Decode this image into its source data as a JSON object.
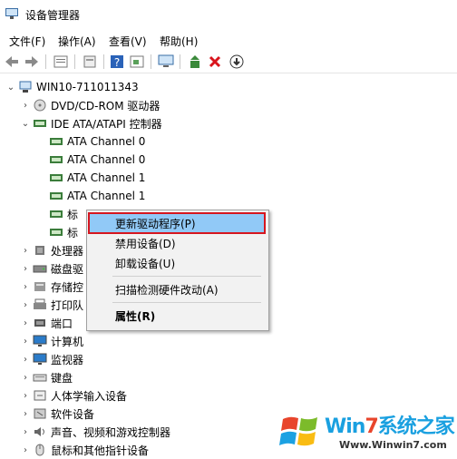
{
  "window": {
    "title": "设备管理器"
  },
  "menu": [
    "文件(F)",
    "操作(A)",
    "查看(V)",
    "帮助(H)"
  ],
  "toolbar_icons": [
    "back-arrow-icon",
    "forward-arrow-icon",
    "properties-icon",
    "show-hidden-icon",
    "help-icon",
    "details-icon",
    "computer-icon",
    "update-driver-icon",
    "uninstall-x-icon",
    "download-icon"
  ],
  "tree": {
    "root": "WIN10-711011343",
    "items": [
      {
        "label": "DVD/CD-ROM 驱动器",
        "level": 1,
        "expand": "›",
        "icon": "dvd"
      },
      {
        "label": "IDE ATA/ATAPI 控制器",
        "level": 1,
        "expand": "⌄",
        "icon": "ide"
      },
      {
        "label": "ATA Channel 0",
        "level": 2,
        "expand": "",
        "icon": "chip"
      },
      {
        "label": "ATA Channel 0",
        "level": 2,
        "expand": "",
        "icon": "chip"
      },
      {
        "label": "ATA Channel 1",
        "level": 2,
        "expand": "",
        "icon": "chip"
      },
      {
        "label": "ATA Channel 1",
        "level": 2,
        "expand": "",
        "icon": "chip"
      },
      {
        "label": "标",
        "level": 2,
        "expand": "",
        "icon": "chip"
      },
      {
        "label": "标",
        "level": 2,
        "expand": "",
        "icon": "chip"
      },
      {
        "label": "处理器",
        "level": 1,
        "expand": "›",
        "icon": "cpu"
      },
      {
        "label": "磁盘驱",
        "level": 1,
        "expand": "›",
        "icon": "disk"
      },
      {
        "label": "存储控",
        "level": 1,
        "expand": "›",
        "icon": "storage"
      },
      {
        "label": "打印队",
        "level": 1,
        "expand": "›",
        "icon": "printer"
      },
      {
        "label": "端口",
        "level": 1,
        "expand": "›",
        "icon": "port"
      },
      {
        "label": "计算机",
        "level": 1,
        "expand": "›",
        "icon": "monitor"
      },
      {
        "label": "监视器",
        "level": 1,
        "expand": "›",
        "icon": "monitor"
      },
      {
        "label": "键盘",
        "level": 1,
        "expand": "›",
        "icon": "keyboard"
      },
      {
        "label": "人体学输入设备",
        "level": 1,
        "expand": "›",
        "icon": "hid"
      },
      {
        "label": "软件设备",
        "level": 1,
        "expand": "›",
        "icon": "software"
      },
      {
        "label": "声音、视频和游戏控制器",
        "level": 1,
        "expand": "›",
        "icon": "sound"
      },
      {
        "label": "鼠标和其他指针设备",
        "level": 1,
        "expand": "›",
        "icon": "mouse"
      }
    ]
  },
  "context_menu": {
    "items": [
      "更新驱动程序(P)",
      "禁用设备(D)",
      "卸载设备(U)",
      "扫描检测硬件改动(A)",
      "属性(R)"
    ]
  },
  "watermark": {
    "brand_a": "Win",
    "brand_b": "7",
    "brand_c": "系统之家",
    "url": "Www.Winwin7.com"
  },
  "colors": {
    "highlight": "#91c9f7",
    "annotation_red": "#d6161f",
    "brand_blue": "#1aa0e0"
  }
}
